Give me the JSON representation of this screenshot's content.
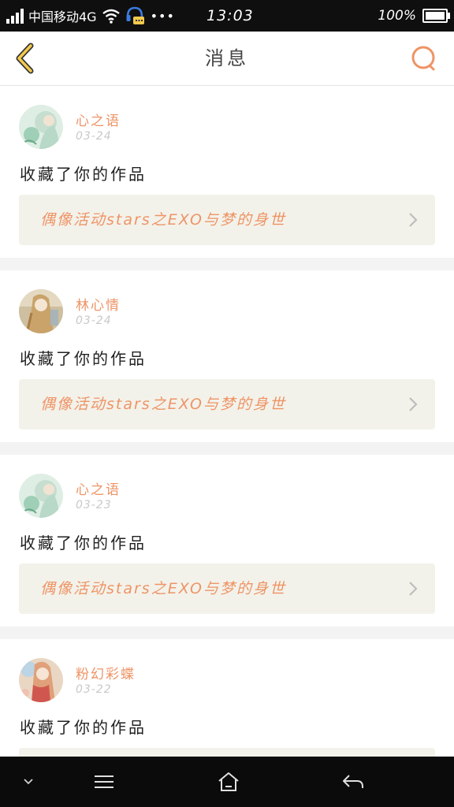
{
  "status_bar": {
    "carrier": "中国移动4G",
    "dots": "•••",
    "time": "13:03",
    "battery": "100%"
  },
  "header": {
    "title": "消息",
    "back_icon": "chevron-left-icon",
    "search_icon": "search-icon"
  },
  "colors": {
    "accent": "#ee9466",
    "back_arrow": "#f2c94c",
    "link_bg": "#f3f2ea"
  },
  "notifications": [
    {
      "user": "心之语",
      "date": "03-24",
      "action": "收藏了你的作品",
      "work": "偶像活动stars之EXO与梦的身世"
    },
    {
      "user": "林心情",
      "date": "03-24",
      "action": "收藏了你的作品",
      "work": "偶像活动stars之EXO与梦的身世"
    },
    {
      "user": "心之语",
      "date": "03-23",
      "action": "收藏了你的作品",
      "work": "偶像活动stars之EXO与梦的身世"
    },
    {
      "user": "粉幻彩蝶",
      "date": "03-22",
      "action": "收藏了你的作品",
      "work": ""
    }
  ],
  "nav_bar": {
    "icons": [
      "chevron-down-icon",
      "menu-icon",
      "home-icon",
      "back-icon"
    ]
  }
}
